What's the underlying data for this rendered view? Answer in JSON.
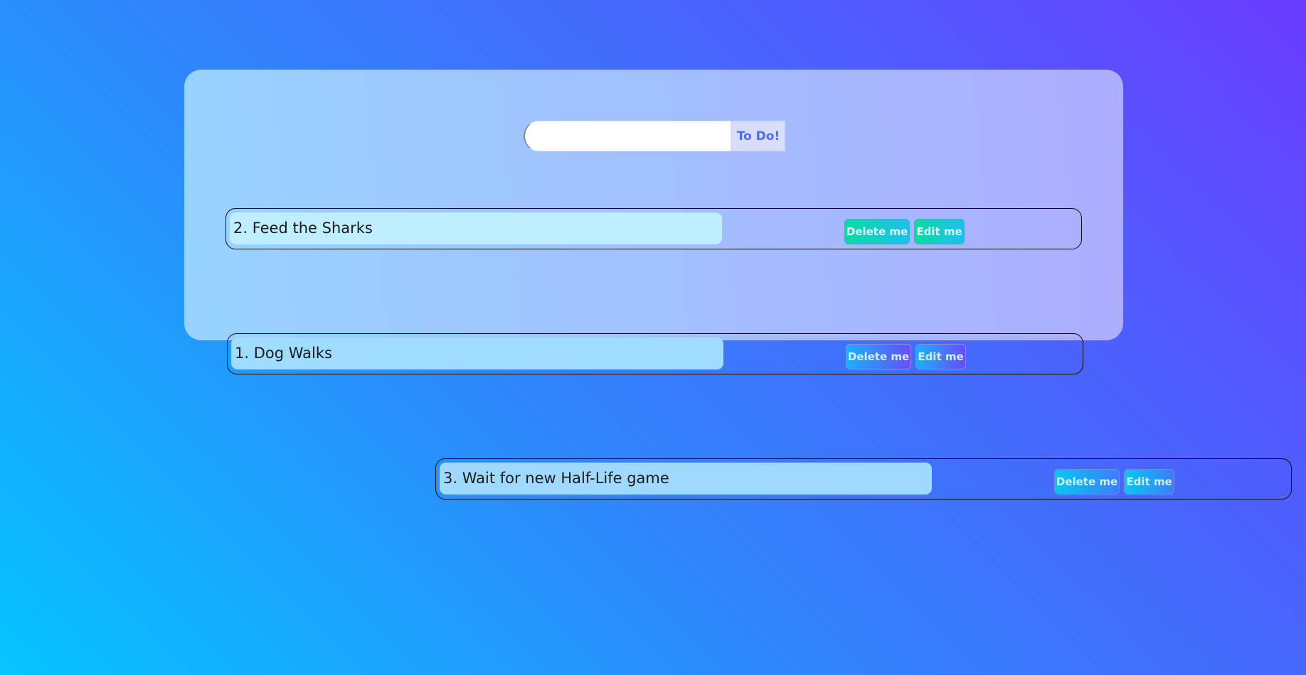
{
  "form": {
    "input_value": "",
    "input_placeholder": "",
    "submit_label": "To Do!"
  },
  "todos": [
    {
      "text": "2. Feed the Sharks",
      "delete_label": "Delete me",
      "edit_label": "Edit me"
    },
    {
      "text": "1. Dog Walks",
      "delete_label": "Delete me",
      "edit_label": "Edit me"
    },
    {
      "text": "3. Wait for new Half-Life game",
      "delete_label": "Delete me",
      "edit_label": "Edit me"
    }
  ],
  "colors": {
    "background_gradient": [
      "#05c4ff",
      "#6a3cff"
    ],
    "submit_text": "#4f6df5",
    "row_border": "#0a0a0a"
  }
}
